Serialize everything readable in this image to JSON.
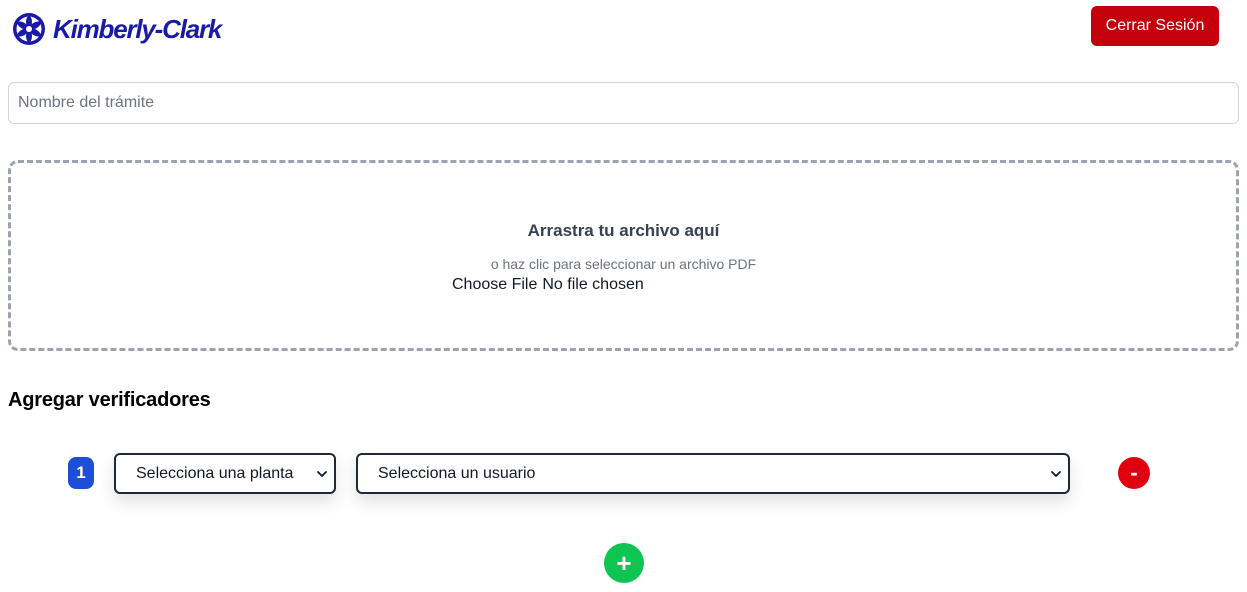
{
  "header": {
    "logo_text": "Kimberly-Clark",
    "logout_label": "Cerrar Sesión",
    "brand_color": "#1a1aa8",
    "logout_color": "#c4000d"
  },
  "form": {
    "name_placeholder": "Nombre del trámite",
    "name_value": ""
  },
  "dropzone": {
    "title": "Arrastra tu archivo aquí",
    "subtitle": "o haz clic para seleccionar un archivo PDF",
    "choose_label": "Choose File",
    "no_file_label": "No file chosen"
  },
  "verifiers": {
    "title": "Agregar verificadores",
    "rows": [
      {
        "index": "1",
        "plant_placeholder": "Selecciona una planta",
        "user_placeholder": "Selecciona un usuario",
        "remove_label": "-"
      }
    ],
    "add_label": "+",
    "badge_color": "#1d4ed8",
    "remove_color": "#e0000f",
    "add_color": "#0ec452"
  }
}
